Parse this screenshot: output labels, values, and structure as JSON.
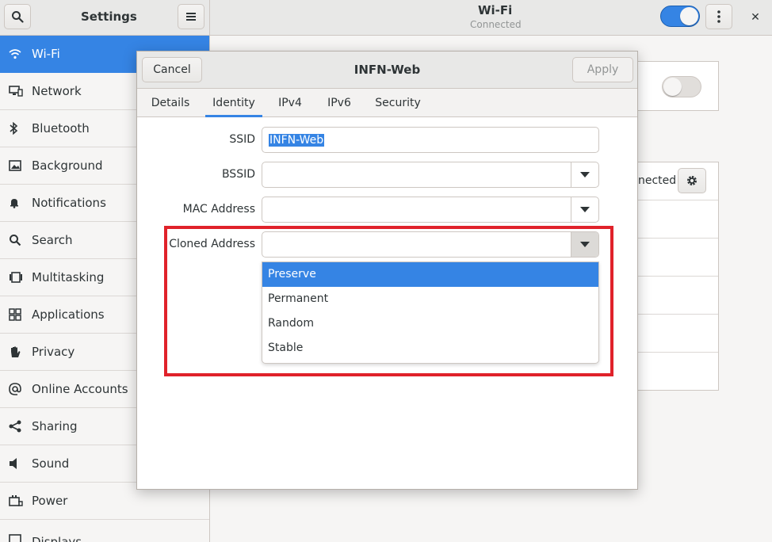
{
  "header": {
    "settings_title": "Settings",
    "wifi_title": "Wi-Fi",
    "wifi_status": "Connected",
    "close_glyph": "✕",
    "icons": [
      "search-icon",
      "hamburger-menu-icon",
      "kebab-menu-icon",
      "close-icon"
    ]
  },
  "sidebar": {
    "items": [
      {
        "label": "Wi-Fi",
        "icon": "wifi-icon"
      },
      {
        "label": "Network",
        "icon": "network-icon"
      },
      {
        "label": "Bluetooth",
        "icon": "bluetooth-icon"
      },
      {
        "label": "Background",
        "icon": "background-icon"
      },
      {
        "label": "Notifications",
        "icon": "bell-icon"
      },
      {
        "label": "Search",
        "icon": "search-icon"
      },
      {
        "label": "Multitasking",
        "icon": "multitasking-icon"
      },
      {
        "label": "Applications",
        "icon": "applications-icon"
      },
      {
        "label": "Privacy",
        "icon": "hand-icon"
      },
      {
        "label": "Online Accounts",
        "icon": "at-icon"
      },
      {
        "label": "Sharing",
        "icon": "share-icon"
      },
      {
        "label": "Sound",
        "icon": "speaker-icon"
      },
      {
        "label": "Power",
        "icon": "power-icon"
      },
      {
        "label": "Displays",
        "icon": "display-icon"
      }
    ],
    "active_index": 0
  },
  "background": {
    "connected_partial": "nected"
  },
  "dialog": {
    "title": "INFN-Web",
    "cancel_label": "Cancel",
    "apply_label": "Apply",
    "tabs": [
      "Details",
      "Identity",
      "IPv4",
      "IPv6",
      "Security"
    ],
    "active_tab": "Identity",
    "fields": {
      "ssid_label": "SSID",
      "ssid_value": "INFN-Web",
      "bssid_label": "BSSID",
      "bssid_value": "",
      "mac_label": "MAC Address",
      "mac_value": "",
      "cloned_label": "Cloned Address",
      "cloned_value": ""
    },
    "cloned_options": [
      "Preserve",
      "Permanent",
      "Random",
      "Stable"
    ],
    "cloned_highlighted": "Preserve"
  },
  "colors": {
    "accent": "#3584e4",
    "annotation_box": "#e0222a"
  }
}
